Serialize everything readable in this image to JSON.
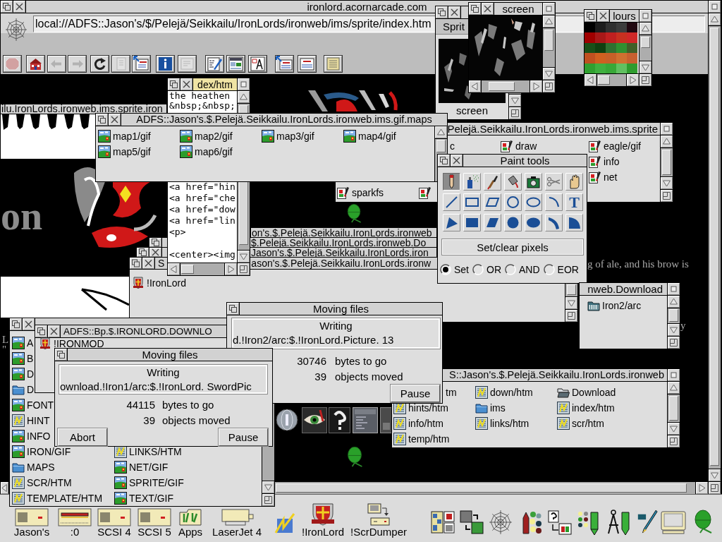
{
  "browser": {
    "title": "ironlord.acornarcade.com",
    "focused": false,
    "url": "local://ADFS::Jason's/$/Pelejä/Seikkailu/IronLords/ironweb/ims/sprite/index.htm",
    "toolbar": [
      {
        "disabled": true
      },
      {
        "disabled": false
      },
      {
        "disabled": true
      },
      {
        "disabled": true
      },
      {
        "disabled": false
      },
      {
        "disabled": true
      },
      {
        "disabled": false
      },
      {
        "disabled": false
      },
      {
        "disabled": true
      },
      {
        "disabled": false
      },
      {
        "disabled": false
      },
      {
        "disabled": false
      },
      {
        "disabled": false
      },
      {
        "disabled": false
      },
      {
        "disabled": false
      }
    ],
    "page": {
      "heading": "on",
      "text_fragments": [
        "g of ale, and his brow is",
        "y",
        "L",
        "\""
      ]
    }
  },
  "windows": [
    {
      "kind": "title_strip",
      "focused": false,
      "title": "ilu.IronLords.ironweb.ims.sprite.iron"
    },
    {
      "kind": "text_editor",
      "focused": true,
      "title": "dex/htm",
      "lines": [
        "the heathen",
        "&nbsp;&nbsp;",
        "<a href=\"hin",
        "<a href=\"che",
        "<a href=\"dow",
        "<a href=\"lin",
        "<p>",
        "<center><img"
      ]
    },
    {
      "kind": "title_strip",
      "focused": false,
      "title": "on's.$.Pelejä.Seikkailu.IronLords.ironweb"
    },
    {
      "kind": "title_strip",
      "focused": false,
      "title": "$.Pelejä.Seikkailu.IronLords.ironweb.Do"
    },
    {
      "kind": "title_strip",
      "focused": false,
      "title": "Jason's.$.Pelejä.Seikkailu.IronLords.iron"
    },
    {
      "kind": "filer",
      "focused": false,
      "title_parts": [
        "S",
        "ason's.$.Pelejä.Seikkailu.IronLords.ironw"
      ],
      "items": [
        {
          "kind": "application",
          "name": "!IronLord"
        }
      ]
    },
    {
      "kind": "sprite_file",
      "focused": false,
      "header": "Sprit",
      "sprites": [
        {
          "name": "screen"
        }
      ]
    },
    {
      "kind": "sprite_view",
      "focused": false,
      "title": "screen"
    },
    {
      "kind": "palette",
      "focused": false,
      "title": "lours",
      "colors": [
        {
          "color": "#000000"
        },
        {
          "color": "#1c1c1c"
        },
        {
          "color": "#303030"
        },
        {
          "color": "#3c3c3c"
        },
        {
          "color": "#200810"
        },
        {
          "color": "#a00000"
        },
        {
          "color": "#a81818"
        },
        {
          "color": "#c02020"
        },
        {
          "color": "#c83020"
        },
        {
          "color": "#d02828"
        },
        {
          "color": "#185018"
        },
        {
          "color": "#104010"
        },
        {
          "color": "#307030"
        },
        {
          "color": "#309030"
        },
        {
          "color": "#406028"
        },
        {
          "color": "#c05020"
        },
        {
          "color": "#d06020"
        },
        {
          "color": "#c86028"
        },
        {
          "color": "#d07030"
        },
        {
          "color": "#c86030"
        },
        {
          "color": "#30a030"
        },
        {
          "color": "#40b040"
        },
        {
          "color": "#38a838"
        },
        {
          "color": "#60c060"
        },
        {
          "color": "#2e9c2e"
        }
      ]
    },
    {
      "kind": "filer",
      "focused": false,
      "title": "Pelejä.Seikkailu.IronLords.ironweb.ims.sprite",
      "items": [
        {
          "name": "c"
        },
        {
          "kind": "sprite_file",
          "name": "draw"
        },
        {
          "kind": "sprite_file",
          "name": "eagle/gif"
        },
        {
          "kind": "sprite_file",
          "name": "info"
        },
        {
          "kind": "sprite_file",
          "name": "net"
        },
        {
          "kind": "sprite_file",
          "name": "sparkfs"
        },
        {
          "kind": "sprite_file"
        }
      ]
    },
    {
      "kind": "filer",
      "focused": false,
      "title": "ADFS::Jason's.$.Pelejä.Seikkailu.IronLords.ironweb.ims.gif.maps",
      "items": [
        {
          "kind": "image",
          "name": "map1/gif"
        },
        {
          "kind": "image",
          "name": "map2/gif"
        },
        {
          "kind": "image",
          "name": "map3/gif"
        },
        {
          "kind": "image",
          "name": "map4/gif"
        },
        {
          "kind": "image",
          "name": "map5/gif"
        },
        {
          "kind": "image",
          "name": "map6/gif"
        }
      ]
    },
    {
      "kind": "paint_tools",
      "focused": false,
      "title": "Paint tools",
      "tools": [
        {
          "selected": true
        },
        {
          "selected": false
        },
        {
          "selected": false
        },
        {
          "selected": false
        },
        {
          "selected": false
        },
        {
          "selected": false
        },
        {
          "selected": false
        },
        {
          "selected": false
        },
        {
          "selected": false
        },
        {
          "selected": false
        },
        {
          "selected": false
        },
        {
          "selected": false
        },
        {
          "selected": false
        },
        {
          "selected": false,
          "label": "T"
        },
        {
          "selected": false
        },
        {
          "selected": false
        },
        {
          "selected": false
        },
        {
          "selected": false
        },
        {
          "selected": false
        },
        {
          "selected": false
        },
        {
          "selected": false
        }
      ],
      "description": "Set/clear pixels",
      "modes": [
        {
          "label": "Set",
          "selected": true
        },
        {
          "label": "OR",
          "selected": false
        },
        {
          "label": "AND",
          "selected": false
        },
        {
          "label": "EOR",
          "selected": false
        }
      ]
    },
    {
      "kind": "filer",
      "focused": false,
      "title": "nweb.Download",
      "items": [
        {
          "kind": "archive",
          "name": "Iron2/arc"
        }
      ]
    },
    {
      "kind": "filer",
      "focused": false,
      "items": [
        {
          "kind": "image",
          "name": "A"
        },
        {
          "kind": "image",
          "name": "B"
        },
        {
          "kind": "image",
          "name": "D"
        },
        {
          "kind": "folder",
          "name": "D"
        },
        {
          "kind": "image",
          "name": "FONT"
        },
        {
          "kind": "html",
          "name": "HINT"
        },
        {
          "kind": "image",
          "name": "INFO"
        },
        {
          "kind": "image",
          "name": "IRON/GIF"
        },
        {
          "kind": "html",
          "name": "LINKS/HTM"
        },
        {
          "kind": "folder",
          "name": "MAPS"
        },
        {
          "kind": "image",
          "name": "NET/GIF"
        },
        {
          "kind": "html",
          "name": "SCR/HTM"
        },
        {
          "kind": "image",
          "name": "SPRITE/GIF"
        },
        {
          "kind": "html",
          "name": "TEMPLATE/HTM"
        },
        {
          "kind": "image",
          "name": "TEXT/GIF"
        }
      ]
    },
    {
      "kind": "filer",
      "focused": false,
      "title": "ADFS::Bp.$.IRONLORD.DOWNLO",
      "items": [
        {
          "kind": "application",
          "name": "!IRONMOD"
        }
      ]
    },
    {
      "kind": "filer",
      "focused": false,
      "title": "S::Jason's.$.Pelejä.Seikkailu.IronLords.ironweb",
      "items": [
        {
          "name": "tm"
        },
        {
          "kind": "html",
          "name": "down/htm"
        },
        {
          "kind": "open_folder",
          "name": "Download"
        },
        {
          "kind": "html",
          "name": "hints/htm"
        },
        {
          "kind": "folder",
          "name": "ims"
        },
        {
          "kind": "html",
          "name": "index/htm"
        },
        {
          "kind": "html",
          "name": "info/htm"
        },
        {
          "kind": "html",
          "name": "links/htm"
        },
        {
          "kind": "html",
          "name": "scr/htm"
        },
        {
          "kind": "html",
          "name": "temp/htm"
        }
      ]
    },
    {
      "kind": "progress",
      "focused": false,
      "title": "Moving files",
      "status": "Writing",
      "path": "d.!Iron2/arc:$.!IronLord.Picture. 13",
      "counts": [
        {
          "number": "30746",
          "caption": "bytes to go"
        },
        {
          "number": "39",
          "caption": "objects moved"
        }
      ],
      "buttons": [
        "Pause"
      ]
    },
    {
      "kind": "progress",
      "focused": false,
      "title": "Moving files",
      "status": "Writing",
      "path": "ownload.!Iron1/arc:$.!IronLord. SwordPic",
      "counts": [
        {
          "number": "44115",
          "caption": "bytes to go"
        },
        {
          "number": "39",
          "caption": "objects moved"
        }
      ],
      "buttons": [
        "Abort",
        "Pause"
      ]
    }
  ],
  "iconbar": {
    "devices": [
      {
        "label": "Jason's"
      },
      {
        "label": ":0"
      },
      {
        "label": "SCSI 4"
      },
      {
        "label": "SCSI 5"
      },
      {
        "label": "Apps"
      },
      {
        "label": "LaserJet 4"
      }
    ],
    "applications": [
      {
        "label": "!IronLord"
      },
      {
        "label": "!ScrDumper"
      }
    ]
  }
}
